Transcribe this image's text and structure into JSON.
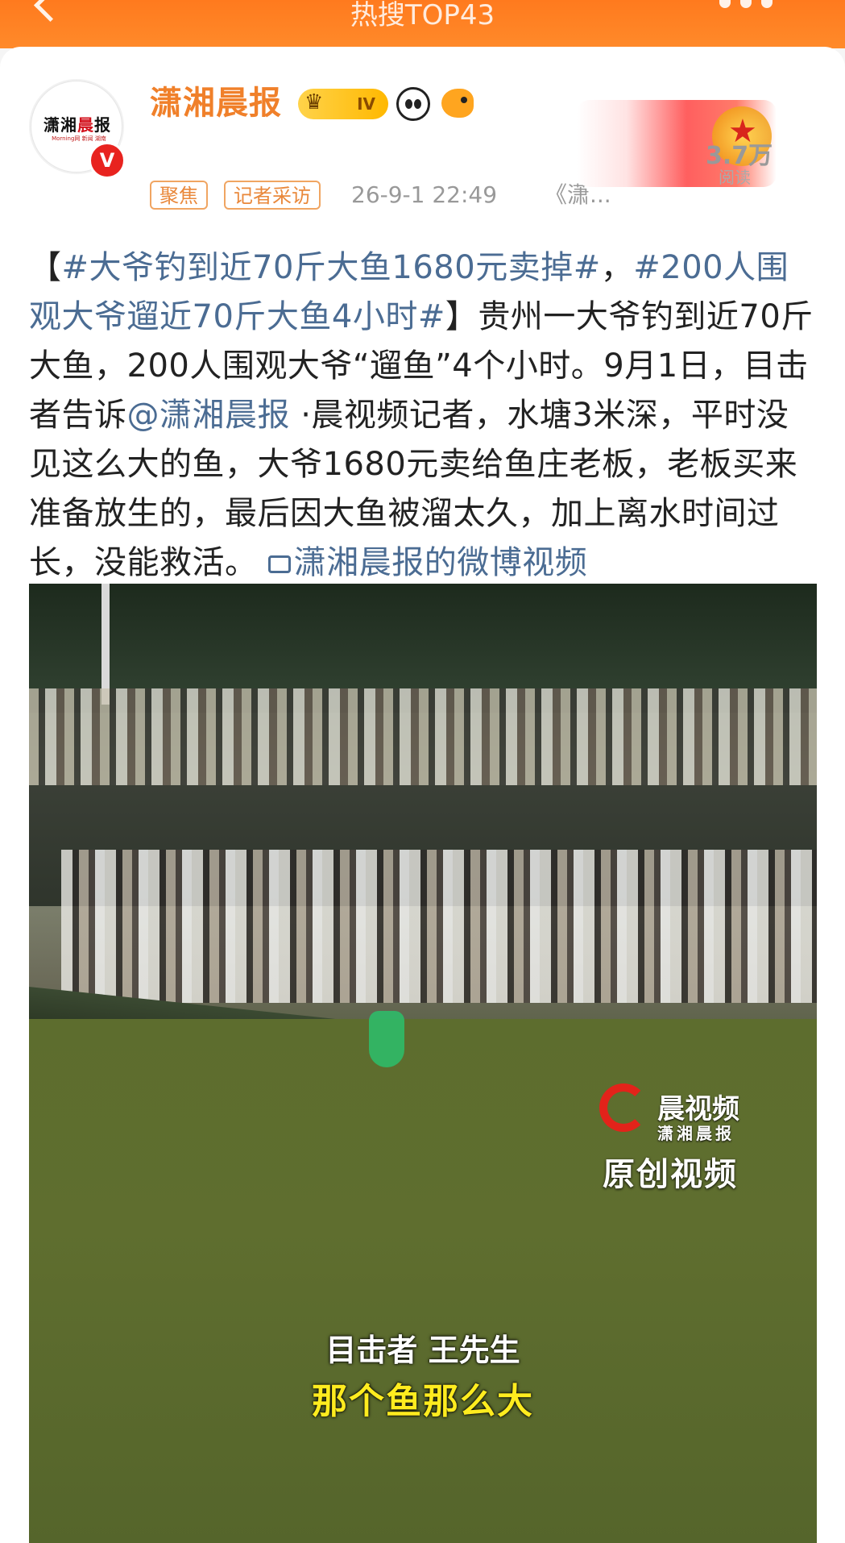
{
  "topbar": {
    "title": "热搜TOP43"
  },
  "post": {
    "author": "潇湘晨报",
    "level": "IV",
    "avatar_logo_main": "潇湘",
    "avatar_logo_red": "晨",
    "avatar_logo_end": "报",
    "avatar_logo_sub": "Morning网 新闻 湖南",
    "verified_mark": "V",
    "tags": [
      "聚焦",
      "记者采访"
    ],
    "time": "26-9-1 22:49",
    "source": "《潇...",
    "read_count": "3.7万",
    "read_label": "阅读",
    "text": {
      "open_bracket": "【",
      "hashtag1": "#大爷钓到近70斤大鱼1680元卖掉#",
      "comma1": "，",
      "hashtag2": "#200人围观大爷遛近70斤大鱼4小时#",
      "body1": "】贵州一大爷钓到近70斤大鱼，200人围观大爷“遛鱼”4个小时。9月1日，目击者告诉",
      "mention": "@潇湘晨报",
      "body2": " ·晨视频记者，水塘3米深，平时没见这么大的鱼，大爷1680元卖给鱼庄老板，老板买来准备放生的，最后因大鱼被溜太久，加上离水时间过长，没能救活。 ",
      "video_link": "潇湘晨报的微博视频"
    }
  },
  "video": {
    "watermark_title": "晨视频",
    "watermark_sub": "潇湘晨报",
    "watermark_original": "原创视频",
    "caption_speaker": "目击者 王先生",
    "caption_line": "那个鱼那么大"
  },
  "colors": {
    "topbar": "#ff7a1e",
    "author_name": "#f0802a",
    "link": "#4b6c93",
    "caption_yellow": "#ffec1f"
  }
}
